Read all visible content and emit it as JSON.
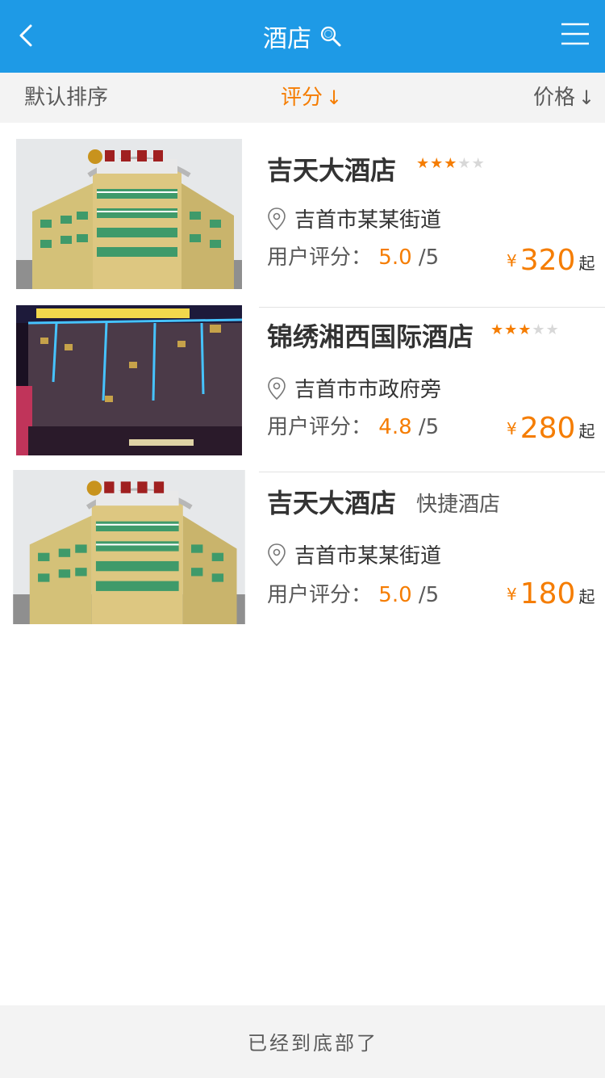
{
  "header": {
    "title": "酒店",
    "back_icon": "chevron-left-icon",
    "search_icon": "search-icon",
    "menu_icon": "menu-icon",
    "bg_color": "#1e9ae6"
  },
  "sort_bar": {
    "default_label": "默认排序",
    "rating_label": "评分",
    "rating_arrow": "↓",
    "price_label": "价格",
    "price_arrow": "↓",
    "active_color": "#f57d02"
  },
  "hotels": [
    {
      "name": "吉天大酒店",
      "stars": 3,
      "address": "吉首市某某街道",
      "rating_label": "用户评分：",
      "score": "5.0",
      "score_max": "/5",
      "currency": "¥",
      "price": "320",
      "price_suffix": "起"
    },
    {
      "name": "锦绣湘西国际酒店",
      "stars": 3,
      "address": "吉首市市政府旁",
      "rating_label": "用户评分：",
      "score": "4.8",
      "score_max": "/5",
      "currency": "¥",
      "price": "280",
      "price_suffix": "起"
    },
    {
      "name": "吉天大酒店",
      "type_tag": "快捷酒店",
      "address": "吉首市某某街道",
      "rating_label": "用户评分：",
      "score": "5.0",
      "score_max": "/5",
      "currency": "¥",
      "price": "180",
      "price_suffix": "起"
    }
  ],
  "footer": {
    "text": "已经到底部了"
  }
}
